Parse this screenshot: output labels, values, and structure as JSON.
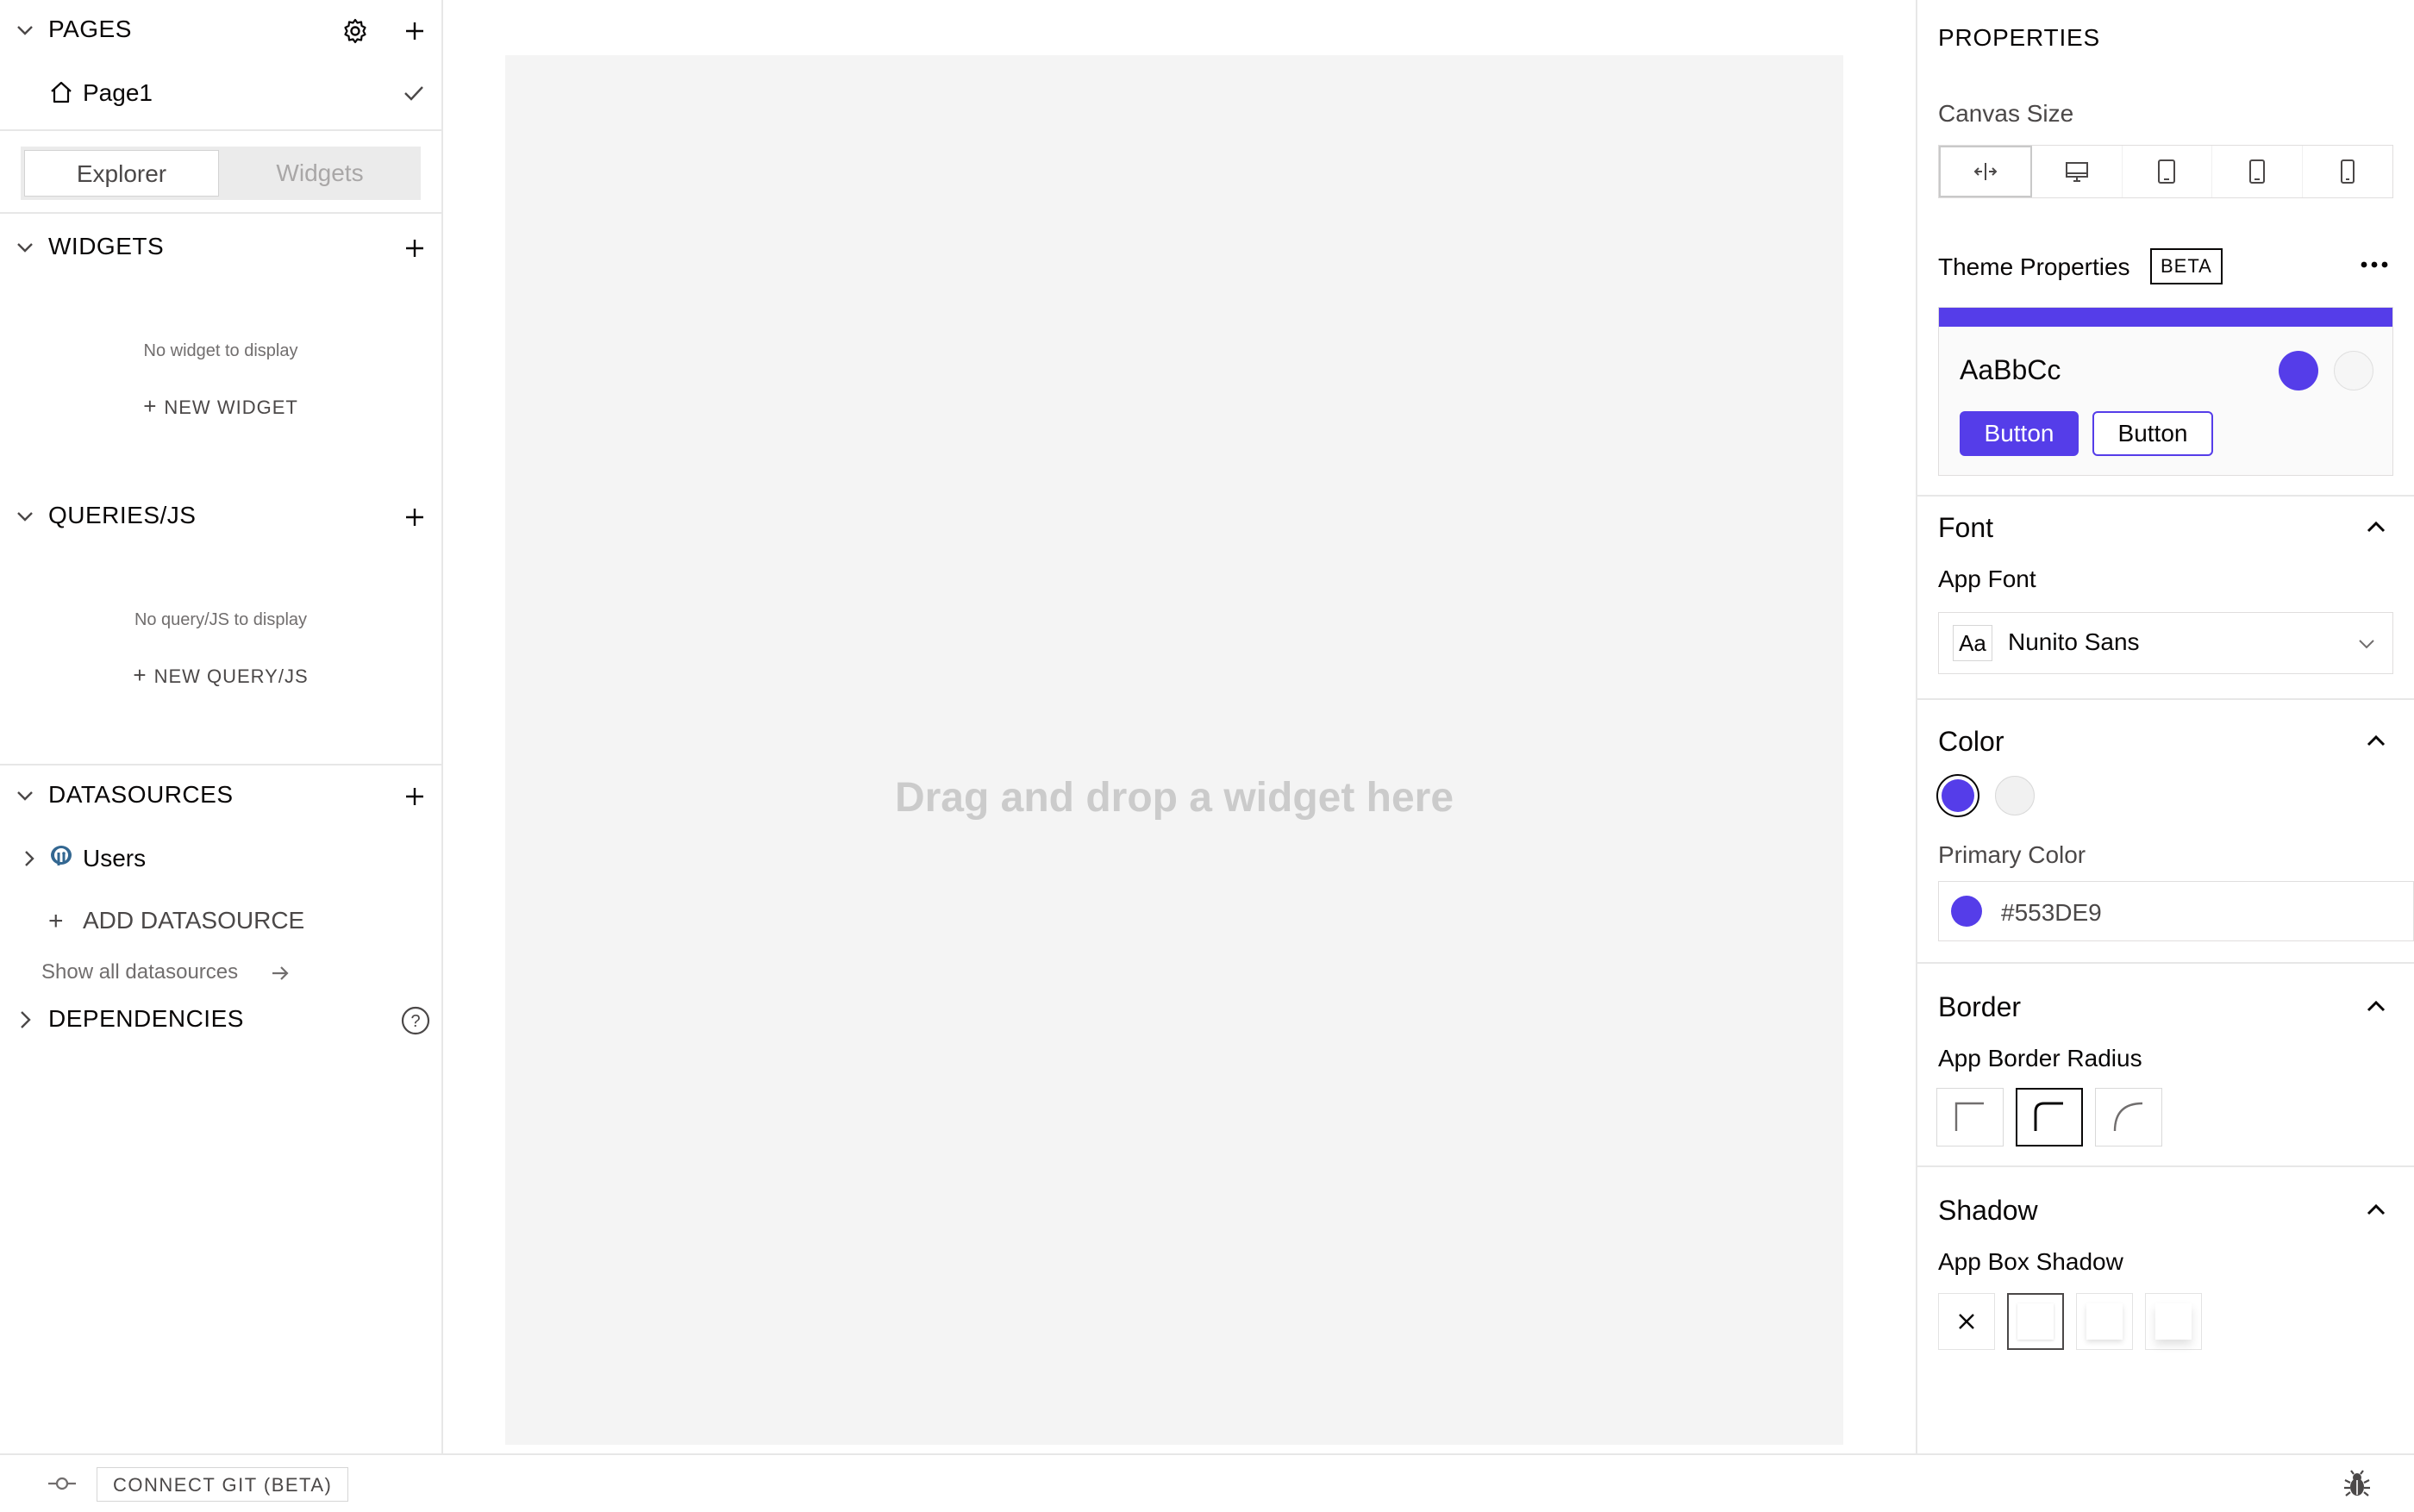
{
  "sidebar": {
    "pages": {
      "title": "PAGES",
      "items": [
        {
          "label": "Page1"
        }
      ]
    },
    "toggle": {
      "explorer": "Explorer",
      "widgets": "Widgets"
    },
    "widgets": {
      "title": "WIDGETS",
      "empty": "No widget to display",
      "new_label": "NEW WIDGET"
    },
    "queries": {
      "title": "QUERIES/JS",
      "empty": "No query/JS to display",
      "new_label": "NEW QUERY/JS"
    },
    "datasources": {
      "title": "DATASOURCES",
      "items": [
        {
          "label": "Users",
          "icon": "postgres-icon"
        }
      ],
      "add_label": "ADD DATASOURCE",
      "show_all": "Show all datasources"
    },
    "dependencies": {
      "title": "DEPENDENCIES"
    }
  },
  "canvas": {
    "hint": "Drag and drop a widget here"
  },
  "properties": {
    "title": "PROPERTIES",
    "canvas_size_label": "Canvas Size",
    "canvas_sizes": [
      "fluid",
      "desktop",
      "tablet-large",
      "tablet",
      "mobile"
    ],
    "selected_canvas_size": "fluid",
    "theme": {
      "label": "Theme Properties",
      "badge": "BETA",
      "preview_text": "AaBbCc",
      "primary_button": "Button",
      "secondary_button": "Button"
    },
    "font": {
      "title": "Font",
      "app_font_label": "App Font",
      "app_font_prefix": "Aa",
      "app_font_value": "Nunito Sans"
    },
    "color": {
      "title": "Color",
      "primary_label": "Primary Color",
      "primary_value": "#553DE9",
      "swatches": [
        "#553de9",
        "#f1f1f1"
      ]
    },
    "border": {
      "title": "Border",
      "radius_label": "App Border Radius",
      "options": [
        "none",
        "medium",
        "large"
      ],
      "selected": "medium"
    },
    "shadow": {
      "title": "Shadow",
      "shadow_label": "App Box Shadow",
      "options": [
        "none",
        "small",
        "medium",
        "large"
      ],
      "selected": "small"
    }
  },
  "bottombar": {
    "git_label": "CONNECT GIT (BETA)"
  },
  "colors": {
    "accent": "#553de9",
    "canvas_bg": "#f4f4f4",
    "border": "#e7e7e7"
  }
}
